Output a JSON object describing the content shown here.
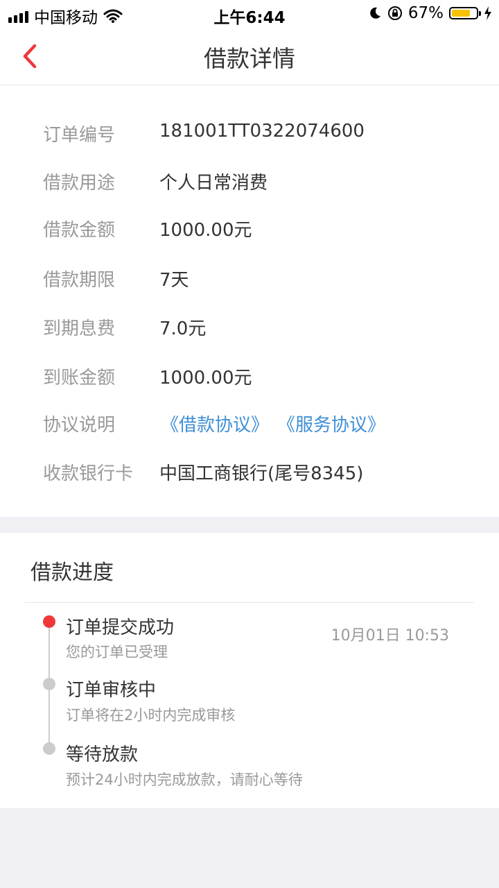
{
  "status_bar": {
    "carrier": "中国移动",
    "time": "上午6:44",
    "battery": "67%"
  },
  "nav": {
    "title": "借款详情"
  },
  "details": [
    {
      "label": "订单编号",
      "value": "181001TT0322074600"
    },
    {
      "label": "借款用途",
      "value": "个人日常消费"
    },
    {
      "label": "借款金额",
      "value": "1000.00元"
    },
    {
      "label": "借款期限",
      "value": "7天"
    },
    {
      "label": "到期息费",
      "value": "7.0元"
    },
    {
      "label": "到账金额",
      "value": "1000.00元"
    },
    {
      "label": "协议说明",
      "links": [
        "《借款协议》",
        "《服务协议》"
      ]
    },
    {
      "label": "收款银行卡",
      "value": "中国工商银行(尾号8345)"
    }
  ],
  "progress": {
    "title": "借款进度",
    "steps": [
      {
        "title": "订单提交成功",
        "subtitle": "您的订单已受理",
        "time": "10月01日 10:53",
        "active": true
      },
      {
        "title": "订单审核中",
        "subtitle": "订单将在2小时内完成审核",
        "active": false
      },
      {
        "title": "等待放款",
        "subtitle": "预计24小时内完成放款，请耐心等待",
        "active": false
      }
    ]
  },
  "colors": {
    "accent_red": "#f0373a",
    "link_blue": "#3f8fd6",
    "battery_yellow": "#f7c300"
  }
}
